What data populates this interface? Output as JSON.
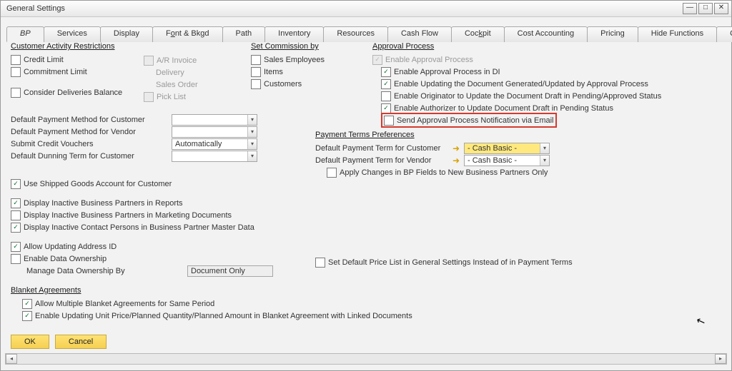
{
  "window": {
    "title": "General Settings"
  },
  "tabs": {
    "t0": "BP",
    "t1": "Services",
    "t2": "Display",
    "t3": "Font & Bkgd",
    "t4": "Path",
    "t5": "Inventory",
    "t6": "Resources",
    "t7": "Cash Flow",
    "t8": "Cockpit",
    "t9": "Cost Accounting",
    "t10": "Pricing",
    "t11": "Hide Functions",
    "t12": "QR Codes"
  },
  "sections": {
    "car": "Customer Activity Restrictions",
    "commission": "Set Commission by",
    "approval": "Approval Process",
    "ptp": "Payment Terms Preferences",
    "blanket": "Blanket Agreements"
  },
  "car": {
    "credit": "Credit Limit",
    "commit": "Commitment Limit",
    "consider": "Consider Deliveries Balance"
  },
  "docs": {
    "ar": "A/R Invoice",
    "delivery": "Delivery",
    "so": "Sales Order",
    "pick": "Pick List"
  },
  "comm": {
    "se": "Sales Employees",
    "items": "Items",
    "cust": "Customers"
  },
  "appr": {
    "enable": "Enable Approval Process",
    "di": "Enable Approval Process in DI",
    "upd": "Enable Updating the Document Generated/Updated by Approval Process",
    "orig": "Enable Originator to Update the Document Draft in Pending/Approved Status",
    "auth": "Enable Authorizer to Update Document Draft in Pending Status",
    "email": "Send Approval Process Notification via Email"
  },
  "defaults": {
    "dpm_cust": "Default Payment Method for Customer",
    "dpm_vend": "Default Payment Method for Vendor",
    "scv": "Submit Credit Vouchers",
    "scv_val": "Automatically",
    "ddt": "Default Dunning Term for Customer"
  },
  "ptp": {
    "cust": "Default Payment Term for Customer",
    "vend": "Default Payment Term for Vendor",
    "cash": "- Cash Basic -",
    "apply": "Apply Changes in BP Fields to New Business Partners Only"
  },
  "misc": {
    "shipped": "Use Shipped Goods Account for Customer",
    "inactive_rpt": "Display Inactive Business Partners in Reports",
    "inactive_mkt": "Display Inactive Business Partners in Marketing Documents",
    "inactive_contact": "Display Inactive Contact Persons in Business Partner Master Data",
    "addr": "Allow Updating Address ID",
    "own": "Enable Data Ownership",
    "own_by": "Manage Data Ownership By",
    "own_val": "Document Only",
    "pricelist": "Set Default Price List in General Settings Instead of in Payment Terms"
  },
  "blanket": {
    "multi": "Allow Multiple Blanket Agreements for Same Period",
    "unit": "Enable Updating Unit Price/Planned Quantity/Planned Amount in Blanket Agreement with Linked Documents"
  },
  "buttons": {
    "ok": "OK",
    "cancel": "Cancel"
  }
}
